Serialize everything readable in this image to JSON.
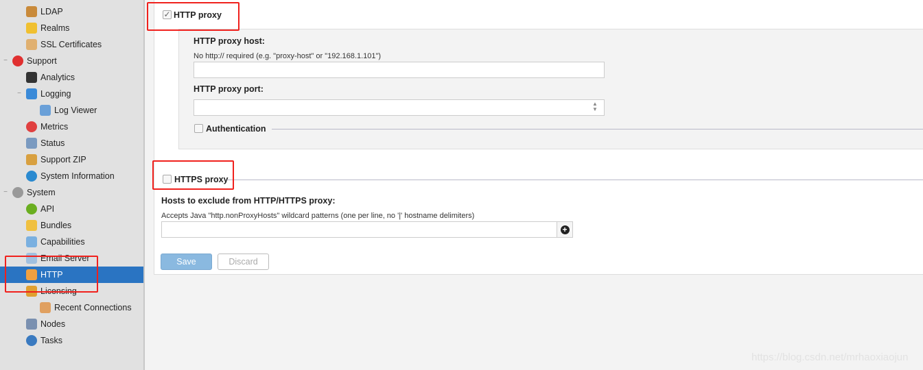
{
  "sidebar": {
    "items": [
      {
        "label": "LDAP",
        "icon": "ldap-icon",
        "color": "#c98a3a"
      },
      {
        "label": "Realms",
        "icon": "shield-icon",
        "color": "#f0c030"
      },
      {
        "label": "SSL Certificates",
        "icon": "certificate-icon",
        "color": "#e0b070"
      },
      {
        "label": "Support",
        "icon": "lifebuoy-icon",
        "color": "#e03030"
      },
      {
        "label": "Analytics",
        "icon": "analytics-icon",
        "color": "#333333"
      },
      {
        "label": "Logging",
        "icon": "logging-icon",
        "color": "#3a8ad8"
      },
      {
        "label": "Log Viewer",
        "icon": "log-viewer-icon",
        "color": "#6aa0d8"
      },
      {
        "label": "Metrics",
        "icon": "pie-chart-icon",
        "color": "#e04040"
      },
      {
        "label": "Status",
        "icon": "status-icon",
        "color": "#7a9ac0"
      },
      {
        "label": "Support ZIP",
        "icon": "zip-icon",
        "color": "#d8a040"
      },
      {
        "label": "System Information",
        "icon": "globe-icon",
        "color": "#2a8ad0"
      },
      {
        "label": "System",
        "icon": "gear-icon",
        "color": "#999999"
      },
      {
        "label": "API",
        "icon": "api-icon",
        "color": "#6aae20"
      },
      {
        "label": "Bundles",
        "icon": "puzzle-icon",
        "color": "#f0c040"
      },
      {
        "label": "Capabilities",
        "icon": "cube-icon",
        "color": "#7ab0e0"
      },
      {
        "label": "Email Server",
        "icon": "email-icon",
        "color": "#a0c0e0"
      },
      {
        "label": "HTTP",
        "icon": "truck-icon",
        "color": "#f0a040"
      },
      {
        "label": "Licensing",
        "icon": "license-icon",
        "color": "#e0a030"
      },
      {
        "label": "Recent Connections",
        "icon": "connections-icon",
        "color": "#e0a060"
      },
      {
        "label": "Nodes",
        "icon": "nodes-icon",
        "color": "#7a90b0"
      },
      {
        "label": "Tasks",
        "icon": "clock-icon",
        "color": "#3a7ac0"
      }
    ],
    "selected": "HTTP",
    "selected_color": "#2a74c2"
  },
  "http_proxy": {
    "label": "HTTP proxy",
    "checked": true,
    "host_label": "HTTP proxy host:",
    "host_hint": "No http:// required (e.g. \"proxy-host\" or \"192.168.1.101\")",
    "host_value": "",
    "port_label": "HTTP proxy port:",
    "port_value": "",
    "auth_label": "Authentication"
  },
  "https_proxy": {
    "label": "HTTPS proxy",
    "checked": false
  },
  "exclude": {
    "label": "Hosts to exclude from HTTP/HTTPS proxy:",
    "hint": "Accepts Java \"http.nonProxyHosts\" wildcard patterns (one per line, no '|' hostname delimiters)",
    "value": ""
  },
  "buttons": {
    "save": "Save",
    "discard": "Discard"
  },
  "watermark": "https://blog.csdn.net/mrhaoxiaojun"
}
